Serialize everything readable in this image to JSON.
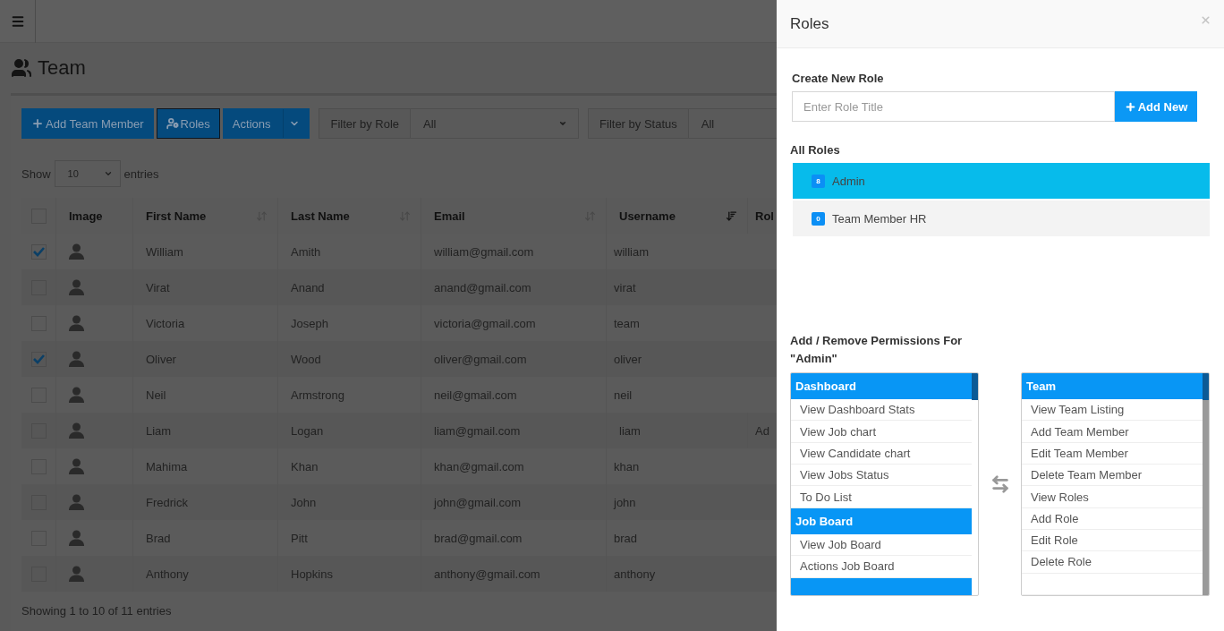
{
  "page": {
    "title": "Team"
  },
  "toolbar": {
    "buttons": [
      {
        "label": "Add Team Member",
        "kind": "add",
        "selected": false
      },
      {
        "label": "Roles",
        "kind": "roles",
        "selected": true
      },
      {
        "label": "Actions",
        "kind": "dropdown",
        "selected": false
      }
    ],
    "filters": [
      {
        "label": "Filter by Role",
        "value": "All"
      },
      {
        "label": "Filter by Status",
        "value": "All"
      }
    ]
  },
  "length": {
    "before": "Show",
    "value": "10",
    "after": "entries"
  },
  "table": {
    "all_checked": false,
    "image_column": "Image",
    "columns": [
      {
        "label": "First Name",
        "sortable": true,
        "sorted": false
      },
      {
        "label": "Last Name",
        "sortable": true,
        "sorted": false
      },
      {
        "label": "Email",
        "sortable": true,
        "sorted": false
      },
      {
        "label": "Username",
        "sortable": true,
        "sorted": true
      },
      {
        "label": "Rol"
      }
    ],
    "rows": [
      {
        "checked": true,
        "cells": [
          "William",
          "Amith",
          "william@gmail.com",
          "william"
        ]
      },
      {
        "checked": false,
        "cells": [
          "Virat",
          "Anand",
          "anand@gmail.com",
          "virat"
        ]
      },
      {
        "checked": false,
        "cells": [
          "Victoria",
          "Joseph",
          "victoria@gmail.com",
          "team"
        ]
      },
      {
        "checked": true,
        "cells": [
          "Oliver",
          "Wood",
          "oliver@gmail.com",
          "oliver"
        ]
      },
      {
        "checked": false,
        "cells": [
          "Neil",
          "Armstrong",
          "neil@gmail.com",
          "neil"
        ]
      },
      {
        "checked": false,
        "cells": [
          "Liam",
          "Logan",
          "liam@gmail.com",
          "liam",
          "Ad"
        ]
      },
      {
        "checked": false,
        "cells": [
          "Mahima",
          "Khan",
          "khan@gmail.com",
          "khan"
        ]
      },
      {
        "checked": false,
        "cells": [
          "Fredrick",
          "John",
          "john@gmail.com",
          "john"
        ]
      },
      {
        "checked": false,
        "cells": [
          "Brad",
          "Pitt",
          "brad@gmail.com",
          "brad"
        ]
      },
      {
        "checked": false,
        "cells": [
          "Anthony",
          "Hopkins",
          "anthony@gmail.com",
          "anthony"
        ]
      }
    ]
  },
  "footer": "Showing 1 to 10 of 11 entries",
  "drawer": {
    "title": "Roles",
    "create": {
      "label": "Create New Role",
      "placeholder": "Enter Role Title",
      "button": "Add New"
    },
    "roles_label": "All Roles",
    "roles": [
      {
        "name": "Admin",
        "count": "8",
        "selected": true
      },
      {
        "name": "Team Member HR",
        "count": "0",
        "selected": false
      }
    ],
    "permissions_title": "Add / Remove Permissions For \"Admin\"",
    "available": [
      {
        "group": "Dashboard",
        "items": [
          "View Dashboard Stats",
          "View Job chart",
          "View Candidate chart",
          "View Jobs Status",
          "To Do List"
        ]
      },
      {
        "group": "Job Board",
        "items": [
          "View Job Board",
          "Actions Job Board"
        ]
      }
    ],
    "assigned": [
      {
        "group": "Team",
        "items": [
          "View Team Listing",
          "Add Team Member",
          "Edit Team Member",
          "Delete Team Member",
          "View Roles",
          "Add Role",
          "Edit Role",
          "Delete Role"
        ]
      }
    ]
  }
}
